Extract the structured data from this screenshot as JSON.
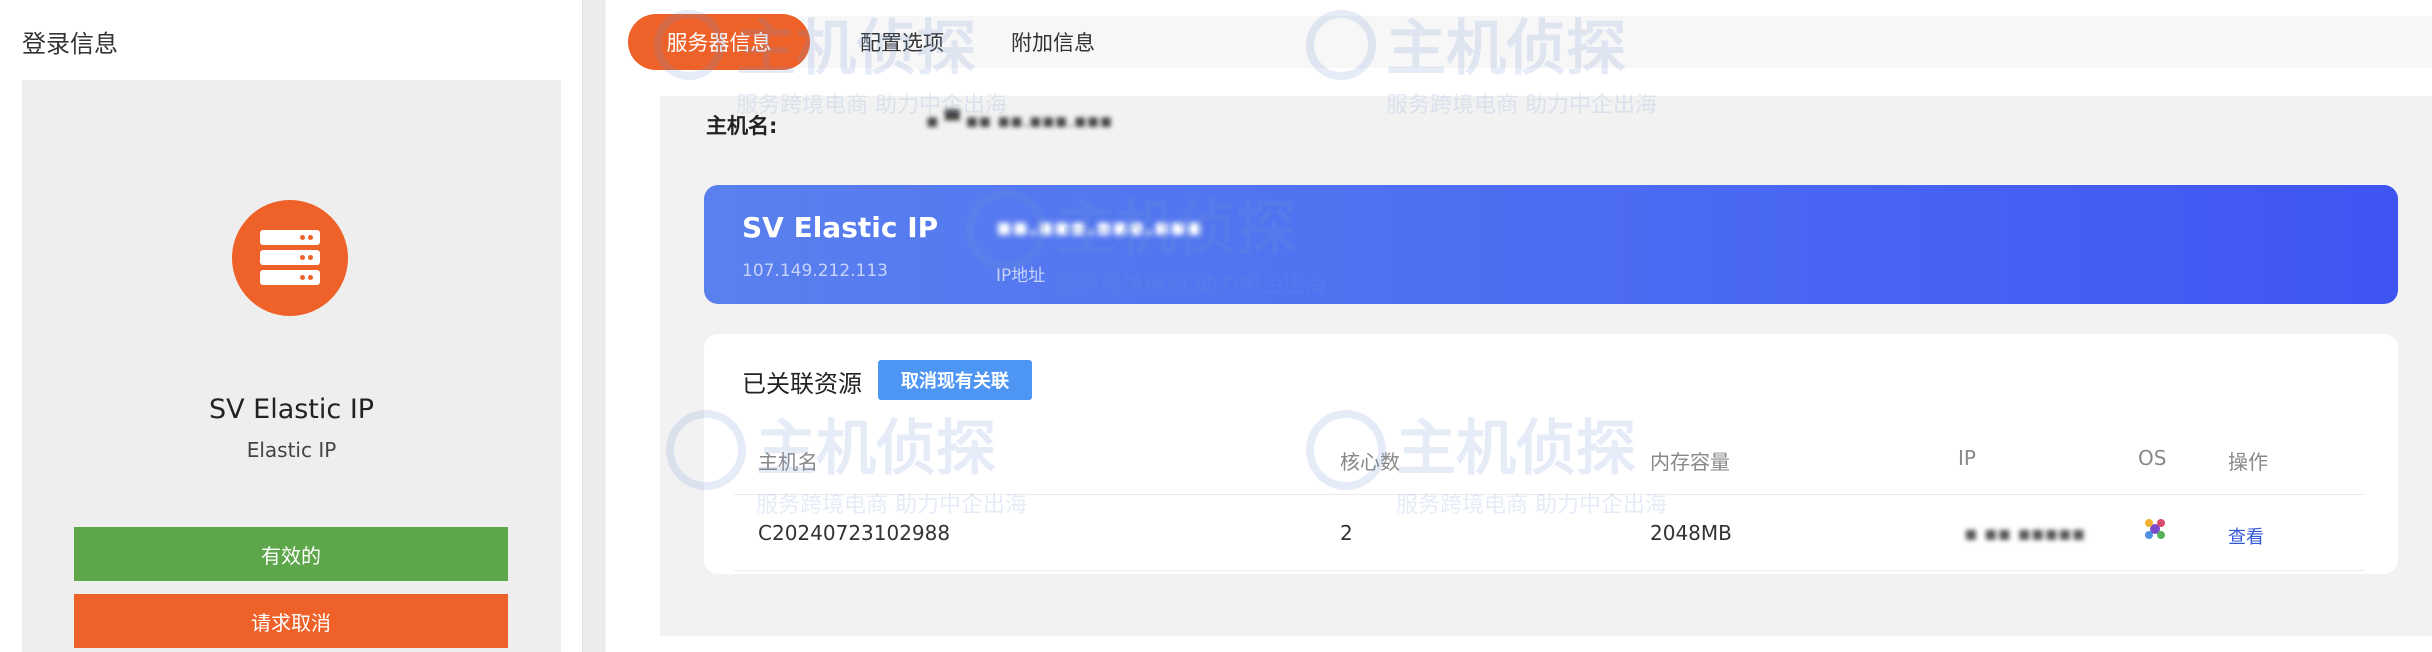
{
  "left_panel": {
    "title": "登录信息",
    "card": {
      "name": "SV Elastic IP",
      "type": "Elastic IP",
      "icon": "server-icon",
      "status_button": "有效的",
      "cancel_button": "请求取消"
    }
  },
  "tabs": [
    {
      "label": "服务器信息",
      "active": true
    },
    {
      "label": "配置选项",
      "active": false
    },
    {
      "label": "附加信息",
      "active": false
    }
  ],
  "host": {
    "label": "主机名:",
    "value": "▪ ▀ ▪▪ ▪▪.▪▪▪.▪▪▪"
  },
  "banner": {
    "name": "SV Elastic IP",
    "ip": "107.149.212.113",
    "value": "▪▪.▪▪▪.▪▪▪.▪▪▪",
    "value_label": "IP地址"
  },
  "resources": {
    "title": "已关联资源",
    "button": "取消现有关联",
    "columns": [
      "主机名",
      "核心数",
      "内存容量",
      "IP",
      "OS",
      "操作"
    ],
    "rows": [
      {
        "hostname": "C20240723102988",
        "cores": "2",
        "memory": "2048MB",
        "ip": "▪ ▪▪ ▪▪▪▪▪",
        "os": "os-icon",
        "action": "查看"
      }
    ]
  },
  "watermark": {
    "brand": "主机侦探",
    "slogan": "服务跨境电商 助力中企出海"
  },
  "colors": {
    "accent_orange": "#ee6128",
    "green": "#5ea64a",
    "banner_blue": "#4a69f3",
    "button_blue": "#4d96f3",
    "link_blue": "#3357d8"
  }
}
